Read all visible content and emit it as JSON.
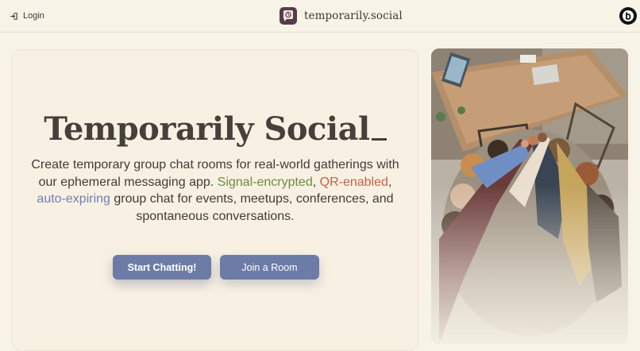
{
  "header": {
    "login_label": "Login",
    "brand_name": "temporarily.social",
    "avatar_letter": "b"
  },
  "hero": {
    "title": "Temporarily Social",
    "description_pre": "Create temporary group chat rooms for real-world gatherings with our ephemeral messaging app. ",
    "highlight_signal": "Signal-encrypted",
    "sep1": ", ",
    "highlight_qr": "QR-enabled",
    "sep2": ", ",
    "highlight_auto": "auto-expiring",
    "description_post": " group chat for events, meetups, conferences, and spontaneous conversations.",
    "start_button": "Start Chatting!",
    "join_button": "Join a Room"
  },
  "colors": {
    "background": "#f8f3e7",
    "accent_button": "#6d7ba7",
    "signal_green": "#6f8a44",
    "qr_red": "#c55f4c",
    "auto_blue": "#6f7fb3",
    "brand_logo": "#5a3a4e"
  },
  "icons": {
    "login": "login-arrow-icon",
    "brand": "chat-bubble-timer-icon",
    "avatar": "user-avatar-icon"
  }
}
